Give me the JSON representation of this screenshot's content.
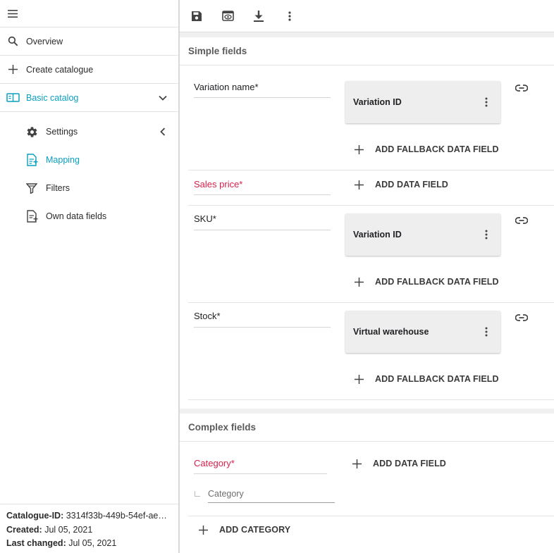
{
  "sidebar": {
    "menu_icon": "hamburger-menu-icon",
    "items": [
      {
        "label": "Overview",
        "icon": "search-icon"
      },
      {
        "label": "Create catalogue",
        "icon": "plus-icon"
      },
      {
        "label": "Basic catalog",
        "icon": "catalog-book-icon"
      }
    ],
    "subitems": [
      {
        "label": "Settings",
        "icon": "gear-icon"
      },
      {
        "label": "Mapping",
        "icon": "mapping-document-icon"
      },
      {
        "label": "Filters",
        "icon": "filter-funnel-icon"
      },
      {
        "label": "Own data fields",
        "icon": "document-add-icon"
      }
    ],
    "footer": {
      "catalogue_id_label": "Catalogue-ID:",
      "catalogue_id_value": " 3314f33b-449b-54ef-ae…",
      "created_label": "Created:",
      "created_value": " Jul 05, 2021",
      "changed_label": "Last changed:",
      "changed_value": " Jul 05, 2021"
    }
  },
  "toolbar": {
    "icons": [
      "save-icon",
      "preview-icon",
      "download-icon",
      "more-vertical-icon"
    ]
  },
  "simple_fields": {
    "title": "Simple fields",
    "rows": [
      {
        "label": "Variation name*",
        "required_highlight": false,
        "chip": "Variation ID",
        "action": "ADD FALLBACK DATA FIELD"
      },
      {
        "label": "Sales price*",
        "required_highlight": true,
        "action": "ADD DATA FIELD"
      },
      {
        "label": "SKU*",
        "required_highlight": false,
        "chip": "Variation ID",
        "action": "ADD FALLBACK DATA FIELD"
      },
      {
        "label": "Stock*",
        "required_highlight": false,
        "chip": "Virtual warehouse",
        "action": "ADD FALLBACK DATA FIELD"
      }
    ]
  },
  "complex_fields": {
    "title": "Complex fields",
    "category_label": "Category*",
    "add_data_field": "ADD DATA FIELD",
    "category_placeholder": "Category",
    "add_category": "ADD CATEGORY"
  },
  "colors": {
    "accent": "#0a9fbf",
    "required": "#d6204b",
    "chip_bg": "#eeeeee",
    "main_bg": "#f0f0f0"
  }
}
